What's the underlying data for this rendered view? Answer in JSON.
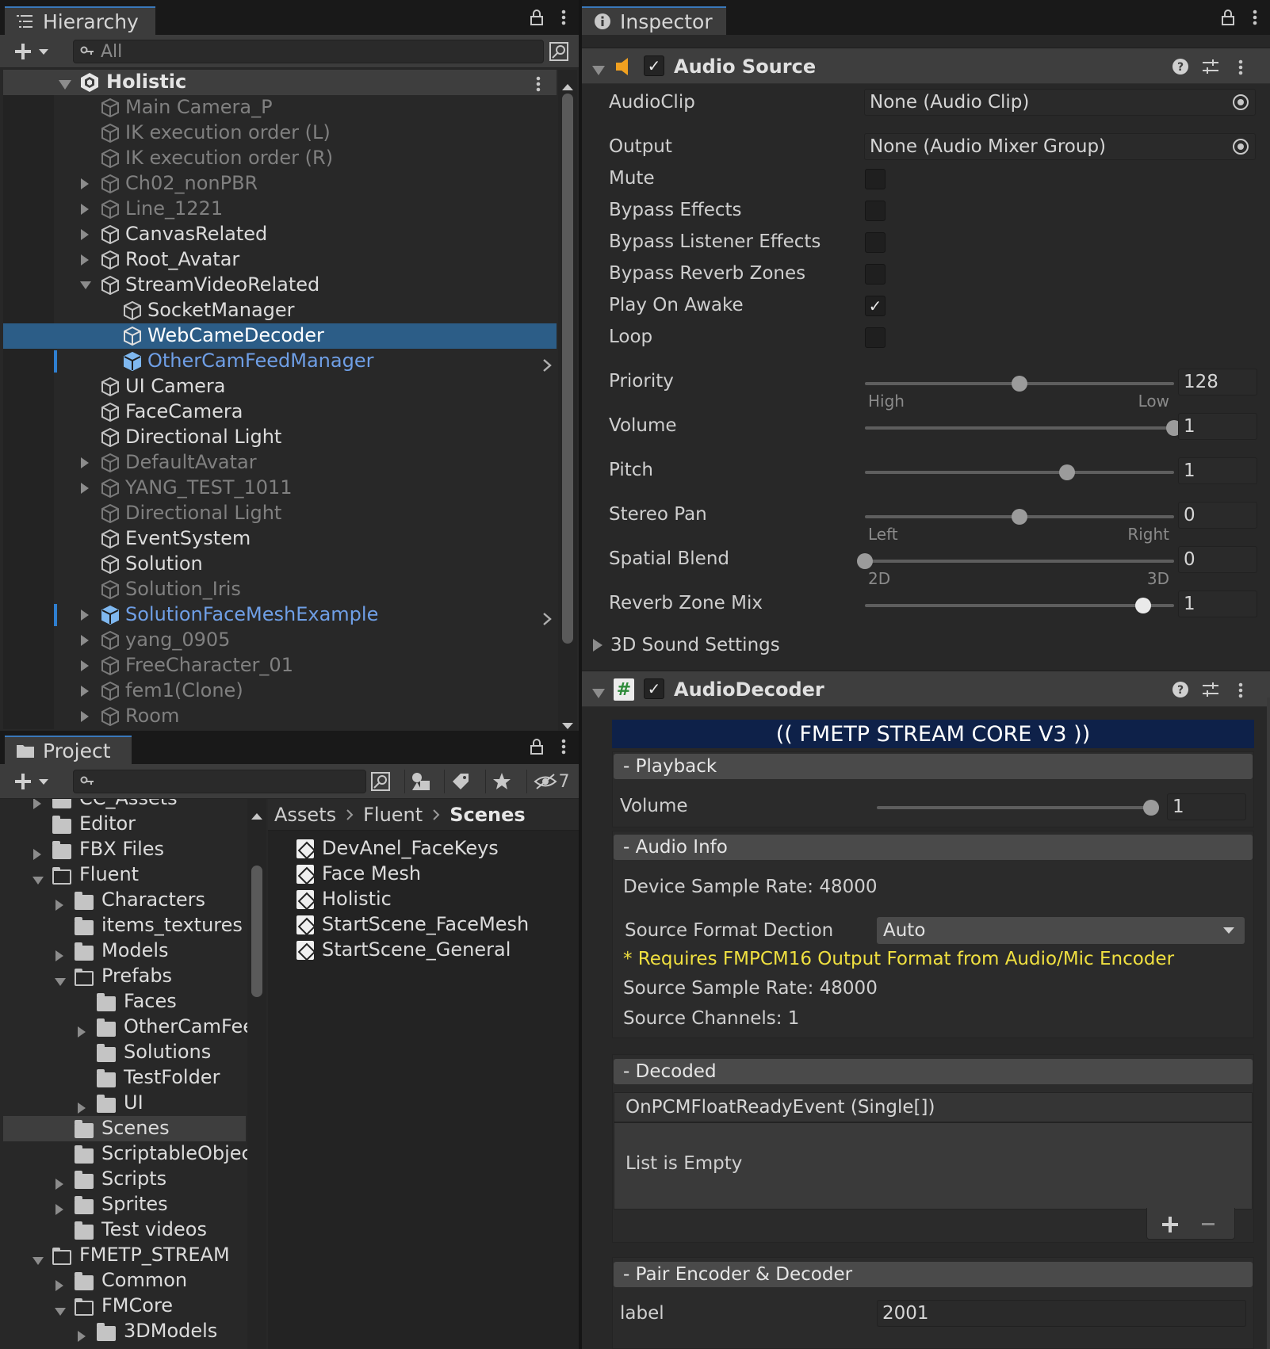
{
  "hierarchy": {
    "tab_title": "Hierarchy",
    "search_placeholder": "All",
    "root": "Holistic",
    "items": [
      {
        "label": "Main Camera_P",
        "state": "dim",
        "arrow": "",
        "depth": 0
      },
      {
        "label": "IK execution order (L)",
        "state": "dim",
        "arrow": "",
        "depth": 0
      },
      {
        "label": "IK execution order (R)",
        "state": "dim",
        "arrow": "",
        "depth": 0
      },
      {
        "label": "Ch02_nonPBR",
        "state": "dim",
        "arrow": "right",
        "depth": 0
      },
      {
        "label": "Line_1221",
        "state": "dim",
        "arrow": "right",
        "depth": 0
      },
      {
        "label": "CanvasRelated",
        "state": "normal",
        "arrow": "right",
        "depth": 0
      },
      {
        "label": "Root_Avatar",
        "state": "normal",
        "arrow": "right",
        "depth": 0
      },
      {
        "label": "StreamVideoRelated",
        "state": "normal",
        "arrow": "down",
        "depth": 0
      },
      {
        "label": "SocketManager",
        "state": "normal",
        "arrow": "",
        "depth": 1
      },
      {
        "label": "WebCameDecoder",
        "state": "selected",
        "arrow": "",
        "depth": 1
      },
      {
        "label": "OtherCamFeedManager",
        "state": "prefab",
        "arrow": "",
        "depth": 1
      },
      {
        "label": "UI Camera",
        "state": "normal",
        "arrow": "",
        "depth": 0
      },
      {
        "label": "FaceCamera",
        "state": "normal",
        "arrow": "",
        "depth": 0
      },
      {
        "label": "Directional Light",
        "state": "normal",
        "arrow": "",
        "depth": 0
      },
      {
        "label": "DefaultAvatar",
        "state": "dim",
        "arrow": "right",
        "depth": 0
      },
      {
        "label": "YANG_TEST_1011",
        "state": "dim",
        "arrow": "right",
        "depth": 0
      },
      {
        "label": "Directional Light",
        "state": "dim",
        "arrow": "",
        "depth": 0
      },
      {
        "label": "EventSystem",
        "state": "normal",
        "arrow": "",
        "depth": 0
      },
      {
        "label": "Solution",
        "state": "normal",
        "arrow": "",
        "depth": 0
      },
      {
        "label": "Solution_Iris",
        "state": "dim",
        "arrow": "",
        "depth": 0
      },
      {
        "label": "SolutionFaceMeshExample",
        "state": "prefab",
        "arrow": "right",
        "depth": 0
      },
      {
        "label": "yang_0905",
        "state": "dim",
        "arrow": "right",
        "depth": 0
      },
      {
        "label": "FreeCharacter_01",
        "state": "dim",
        "arrow": "right",
        "depth": 0
      },
      {
        "label": "fem1(Clone)",
        "state": "dim",
        "arrow": "right",
        "depth": 0
      },
      {
        "label": "Room",
        "state": "dim",
        "arrow": "right",
        "depth": 0
      }
    ]
  },
  "project": {
    "tab_title": "Project",
    "hidden_count": "7",
    "tree": [
      {
        "label": "CC_Assets",
        "indent": 0,
        "arrow": "right",
        "open": false
      },
      {
        "label": "Editor",
        "indent": 0,
        "arrow": "",
        "open": false
      },
      {
        "label": "FBX Files",
        "indent": 0,
        "arrow": "right",
        "open": false
      },
      {
        "label": "Fluent",
        "indent": 0,
        "arrow": "down",
        "open": true
      },
      {
        "label": "Characters",
        "indent": 1,
        "arrow": "right",
        "open": false
      },
      {
        "label": "items_textures",
        "indent": 1,
        "arrow": "",
        "open": false
      },
      {
        "label": "Models",
        "indent": 1,
        "arrow": "right",
        "open": false
      },
      {
        "label": "Prefabs",
        "indent": 1,
        "arrow": "down",
        "open": true
      },
      {
        "label": "Faces",
        "indent": 2,
        "arrow": "",
        "open": false
      },
      {
        "label": "OtherCamFee",
        "indent": 2,
        "arrow": "right",
        "open": false
      },
      {
        "label": "Solutions",
        "indent": 2,
        "arrow": "",
        "open": false
      },
      {
        "label": "TestFolder",
        "indent": 2,
        "arrow": "",
        "open": false
      },
      {
        "label": "UI",
        "indent": 2,
        "arrow": "right",
        "open": false
      },
      {
        "label": "Scenes",
        "indent": 1,
        "arrow": "",
        "open": false,
        "selected": true
      },
      {
        "label": "ScriptableObjec",
        "indent": 1,
        "arrow": "",
        "open": false
      },
      {
        "label": "Scripts",
        "indent": 1,
        "arrow": "right",
        "open": false
      },
      {
        "label": "Sprites",
        "indent": 1,
        "arrow": "right",
        "open": false
      },
      {
        "label": "Test videos",
        "indent": 1,
        "arrow": "",
        "open": false
      },
      {
        "label": "FMETP_STREAM",
        "indent": 0,
        "arrow": "down",
        "open": true
      },
      {
        "label": "Common",
        "indent": 1,
        "arrow": "right",
        "open": false
      },
      {
        "label": "FMCore",
        "indent": 1,
        "arrow": "down",
        "open": true
      },
      {
        "label": "3DModels",
        "indent": 2,
        "arrow": "right",
        "open": false
      }
    ],
    "breadcrumb": [
      "Assets",
      "Fluent",
      "Scenes"
    ],
    "files": [
      "DevAnel_FaceKeys",
      "Face Mesh",
      "Holistic",
      "StartScene_FaceMesh",
      "StartScene_General"
    ]
  },
  "inspector": {
    "tab_title": "Inspector",
    "audio_source": {
      "title": "Audio Source",
      "audioclip_label": "AudioClip",
      "audioclip_value": "None (Audio Clip)",
      "output_label": "Output",
      "output_value": "None (Audio Mixer Group)",
      "toggles": [
        {
          "label": "Mute",
          "checked": false
        },
        {
          "label": "Bypass Effects",
          "checked": false
        },
        {
          "label": "Bypass Listener Effects",
          "checked": false
        },
        {
          "label": "Bypass Reverb Zones",
          "checked": false
        },
        {
          "label": "Play On Awake",
          "checked": true
        },
        {
          "label": "Loop",
          "checked": false
        }
      ],
      "sliders": [
        {
          "label": "Priority",
          "value": "128",
          "fraction": 0.5,
          "left": "High",
          "right": "Low"
        },
        {
          "label": "Volume",
          "value": "1",
          "fraction": 1.0,
          "left": "",
          "right": ""
        },
        {
          "label": "Pitch",
          "value": "1",
          "fraction": 0.655,
          "left": "",
          "right": ""
        },
        {
          "label": "Stereo Pan",
          "value": "0",
          "fraction": 0.5,
          "left": "Left",
          "right": "Right"
        },
        {
          "label": "Spatial Blend",
          "value": "0",
          "fraction": 0.0,
          "left": "2D",
          "right": "3D"
        },
        {
          "label": "Reverb Zone Mix",
          "value": "1",
          "fraction": 0.9,
          "left": "",
          "right": ""
        }
      ],
      "sound_settings": "3D Sound Settings"
    },
    "audio_decoder": {
      "title": "AudioDecoder",
      "banner": "(( FMETP STREAM CORE V3 ))",
      "playback_section": "- Playback",
      "volume_label": "Volume",
      "volume_value": "1",
      "volume_fraction": 1.0,
      "audio_info_section": "- Audio Info",
      "device_rate": "Device Sample Rate: 48000",
      "source_format_label": "Source Format Dection",
      "source_format_value": "Auto",
      "requires_note": "* Requires FMPCM16 Output Format from Audio/Mic Encoder",
      "source_rate": "Source Sample Rate: 48000",
      "source_channels": "Source Channels: 1",
      "decoded_section": "- Decoded",
      "event_name": "OnPCMFloatReadyEvent (Single[])",
      "list_empty": "List is Empty",
      "pair_section": "- Pair Encoder & Decoder",
      "label_label": "label",
      "label_value": "2001"
    }
  },
  "colors": {
    "selection": "#2c5d87",
    "prefab": "#6f9fe6",
    "banner_bg": "#0e2149",
    "note": "#f0e040"
  }
}
